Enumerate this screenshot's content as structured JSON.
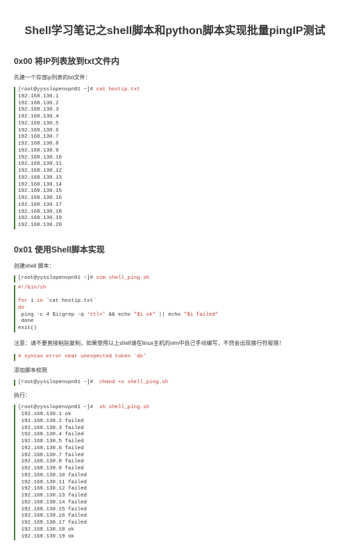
{
  "title": "Shell学习笔记之shell脚本和python脚本实现批量pingIP测试",
  "section0": {
    "heading": "0x00 将IP列表放到txt文件内",
    "intro": "先建一个存放ip列表的txt文件：",
    "prompt": "[root@yysslopenvpn01 ~]# ",
    "cmd": "cat hostip.txt",
    "ips": [
      "192.168.130.1",
      "192.168.130.2",
      "192.168.130.3",
      "192.168.130.4",
      "192.168.130.5",
      "192.168.130.6",
      "192.168.130.7",
      "192.168.130.8",
      "192.168.130.9",
      "192.168.130.10",
      "192.168.130.11",
      "192.168.130.12",
      "192.168.130.13",
      "192.168.130.14",
      "192.168.130.15",
      "192.168.130.16",
      "192.168.130.17",
      "192.168.130.18",
      "192.168.130.19",
      "192.168.130.20"
    ]
  },
  "section1": {
    "heading": "0x01 使用Shell脚本实现",
    "intro1": "创建shell 脚本：",
    "prompt1": "[root@yysslopenvpn01 ~]# ",
    "cmd1": "vim shell_ping.sh",
    "shebang": "#!/bin/sh",
    "line_for_a": "for",
    "line_for_b": " i ",
    "line_for_c": "in",
    "line_for_d": " `cat hostip.txt`",
    "line_do": "do",
    "line_ping_a": " ping -c 4 $i|grep -q ",
    "line_ping_b": "'ttl='",
    "line_ping_c": " && echo ",
    "line_ping_d": "\"$i ok\"",
    "line_ping_e": " || echo ",
    "line_ping_f": "\"$i failed\"",
    "line_done": " done",
    "line_exit": "exit()",
    "warn": "注意：请不要直接粘贴复制，如果使用以上shell请在linux主机的vim中自己手动编写，不然会出现换行符报错！",
    "err_prompt": "-",
    "err_msg": "# syntax error near unexpected token `do'",
    "intro2": "添加脚本权限",
    "prompt2": "[root@yysslopenvpn01 ~]#  ",
    "cmd2": "chmod +x shell_ping.sh",
    "intro3": "执行：",
    "prompt3": "[root@yysslopenvpn01 ~]#  ",
    "cmd3": "sh shell_ping.sh",
    "results": [
      " 192.168.130.1 ok",
      " 192.168.130.2 failed",
      " 192.168.130.3 failed",
      " 192.168.130.4 failed",
      " 192.168.130.5 failed",
      " 192.168.130.6 failed",
      " 192.168.130.7 failed",
      " 192.168.130.8 failed",
      " 192.168.130.9 failed",
      " 192.168.130.10 failed",
      " 192.168.130.11 failed",
      " 192.168.130.12 failed",
      " 192.168.130.13 failed",
      " 192.168.130.14 failed",
      " 192.168.130.15 failed",
      " 192.168.130.16 failed",
      " 192.168.130.17 failed",
      " 192.168.130.18 ok",
      " 192.168.130.19 ok"
    ]
  }
}
